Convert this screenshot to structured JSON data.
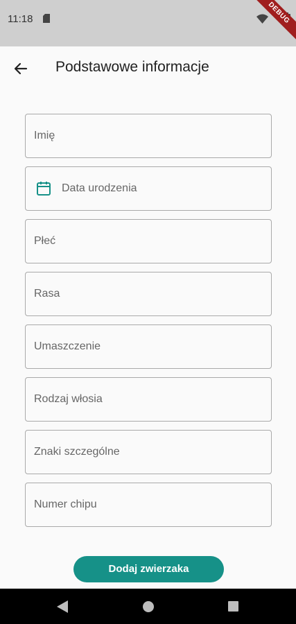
{
  "status_bar": {
    "time": "11:18",
    "debug_banner": "DEBUG",
    "icons": [
      "sim-card-icon",
      "wifi-icon",
      "battery-icon"
    ]
  },
  "app_bar": {
    "title": "Podstawowe informacje",
    "back_icon": "arrow-left-icon"
  },
  "form": {
    "fields": [
      {
        "label": "Imię"
      },
      {
        "label": "Data urodzenia",
        "icon": "calendar-icon"
      },
      {
        "label": "Płeć"
      },
      {
        "label": "Rasa"
      },
      {
        "label": "Umaszczenie"
      },
      {
        "label": "Rodzaj włosia"
      },
      {
        "label": "Znaki szczególne"
      },
      {
        "label": "Numer chipu"
      }
    ],
    "submit_label": "Dodaj zwierzaka"
  },
  "nav_bar": {
    "icons": [
      "nav-back-icon",
      "nav-home-icon",
      "nav-recents-icon"
    ]
  },
  "colors": {
    "accent": "#169188",
    "status_bar_bg": "#cfcfcf",
    "border": "#a9a9a9",
    "debug_banner": "#a01e1e"
  }
}
